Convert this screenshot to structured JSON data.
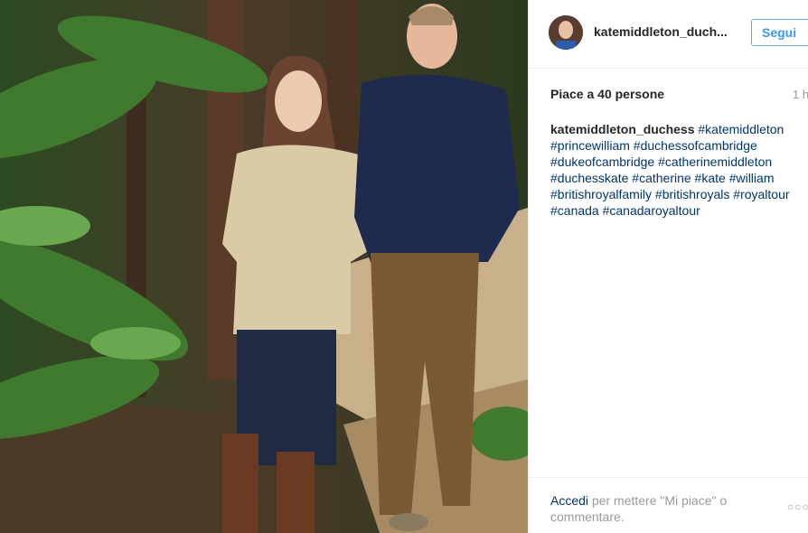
{
  "post": {
    "username": "katemiddleton_duch...",
    "follow_label": "Segui",
    "likes_text": "Piace a 40 persone",
    "time_text": "1 h",
    "caption_user": "katemiddleton_duchess",
    "caption_tags": "#katemiddleton #princewilliam #duchessofcambridge #dukeofcambridge #catherinemiddleton #duchesskate #catherine #kate #william #britishroyalfamily #britishroyals #royaltour #canada #canadaroyaltour",
    "login_link": "Accedi",
    "login_rest": " per mettere \"Mi piace\" o commentare.",
    "more_icon": "more-dots-icon"
  }
}
